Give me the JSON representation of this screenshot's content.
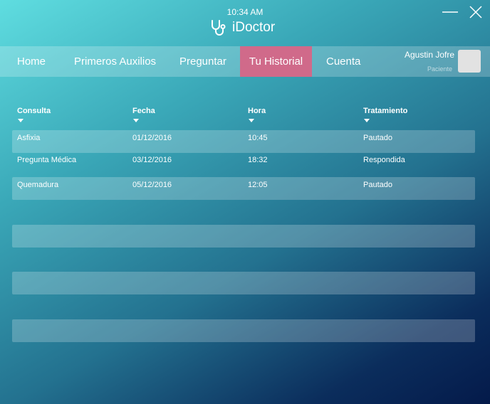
{
  "titlebar": {
    "time": "10:34 AM",
    "app_name": "iDoctor",
    "logo_icon": "stethoscope-icon",
    "minimize_icon": "minimize-icon",
    "close_icon": "close-icon"
  },
  "nav": {
    "items": [
      {
        "label": "Home",
        "active": false
      },
      {
        "label": "Primeros Auxilios",
        "active": false
      },
      {
        "label": "Preguntar",
        "active": false
      },
      {
        "label": "Tu Historial",
        "active": true
      },
      {
        "label": "Cuenta",
        "active": false
      }
    ],
    "active_color": "#d06a8a"
  },
  "user": {
    "name": "Agustin Jofre",
    "role": "Paciente"
  },
  "table": {
    "headers": [
      "Consulta",
      "Fecha",
      "Hora",
      "Tratamiento"
    ],
    "sort_icon": "caret-down-icon",
    "rows": [
      {
        "consulta": "Asfixia",
        "fecha": "01/12/2016",
        "hora": "10:45",
        "tratamiento": "Pautado"
      },
      {
        "consulta": "Pregunta Médica",
        "fecha": "03/12/2016",
        "hora": "18:32",
        "tratamiento": "Respondida"
      },
      {
        "consulta": "Quemadura",
        "fecha": "05/12/2016",
        "hora": "12:05",
        "tratamiento": "Pautado"
      }
    ]
  }
}
